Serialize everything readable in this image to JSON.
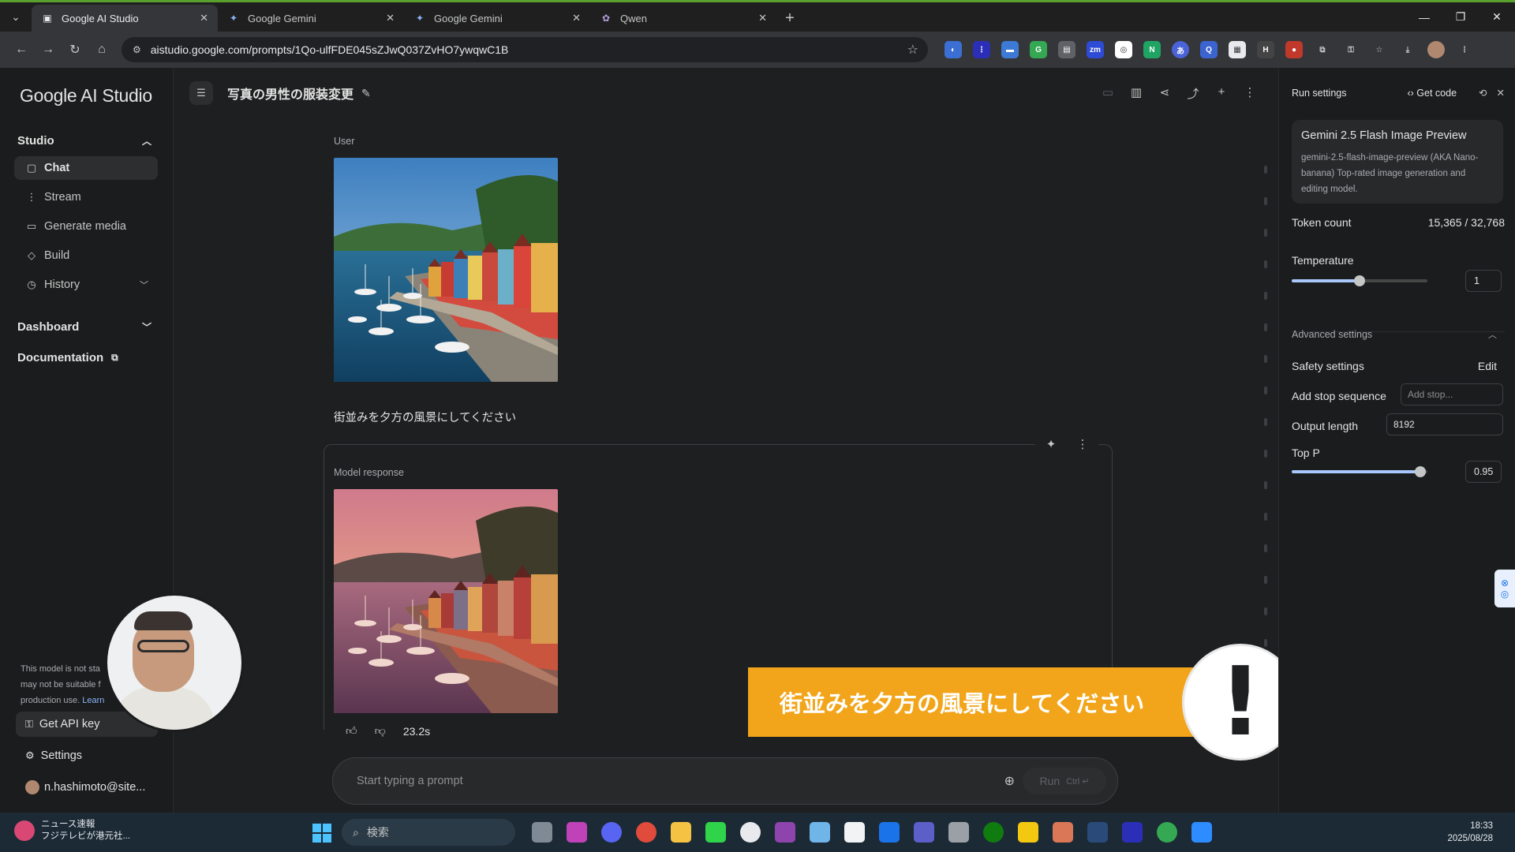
{
  "browser": {
    "tabs": [
      {
        "label": "Google AI Studio",
        "active": true
      },
      {
        "label": "Google Gemini",
        "active": false
      },
      {
        "label": "Google Gemini",
        "active": false
      },
      {
        "label": "Qwen",
        "active": false
      }
    ],
    "url": "aistudio.google.com/prompts/1Qo-ulfFDE045sZJwQ037ZvHO7ywqwC1B"
  },
  "sidebar": {
    "logo": "Google AI Studio",
    "studio_section": "Studio",
    "items": [
      {
        "label": "Chat",
        "icon": "chat-icon"
      },
      {
        "label": "Stream",
        "icon": "stream-icon"
      },
      {
        "label": "Generate media",
        "icon": "media-icon"
      },
      {
        "label": "Build",
        "icon": "build-icon"
      },
      {
        "label": "History",
        "icon": "history-icon"
      }
    ],
    "dashboard": "Dashboard",
    "documentation": "Documentation",
    "notice_lines": [
      "This model is not sta",
      "may not be suitable f",
      "production use."
    ],
    "notice_link": "Learn",
    "get_api_key": "Get API key",
    "settings": "Settings",
    "account": "n.hashimoto@site..."
  },
  "header": {
    "title": "写真の男性の服装変更"
  },
  "chat": {
    "user_label": "User",
    "user_message": "街並みを夕方の風景にしてください",
    "model_label": "Model response",
    "response_time": "23.2s"
  },
  "prompt": {
    "placeholder": "Start typing a prompt",
    "run_label": "Run",
    "run_shortcut": "Ctrl ↵"
  },
  "overlay": {
    "banner_text": "街並みを夕方の風景にしてください",
    "exclamation": "!"
  },
  "settings": {
    "title": "Run settings",
    "get_code": "Get code",
    "model_name": "Gemini 2.5 Flash Image Preview",
    "model_desc": "gemini-2.5-flash-image-preview (AKA Nano-banana) Top-rated image generation and editing model.",
    "token_label": "Token count",
    "token_value": "15,365 / 32,768",
    "temperature_label": "Temperature",
    "temperature_value": "1",
    "temperature_level": 0.5,
    "advanced_label": "Advanced settings",
    "safety_label": "Safety settings",
    "safety_edit": "Edit",
    "stop_label": "Add stop sequence",
    "stop_placeholder": "Add stop...",
    "output_label": "Output length",
    "output_value": "8192",
    "topp_label": "Top P",
    "topp_value": "0.95",
    "topp_level": 0.95
  },
  "taskbar": {
    "news_title": "ニュース速報",
    "news_sub": "フジテレビが港元社...",
    "search": "検索",
    "time": "18:33",
    "date": "2025/08/28"
  },
  "colors": {
    "accent": "#a8c7fa",
    "banner": "#f2a51a",
    "background": "#1e1f20"
  }
}
